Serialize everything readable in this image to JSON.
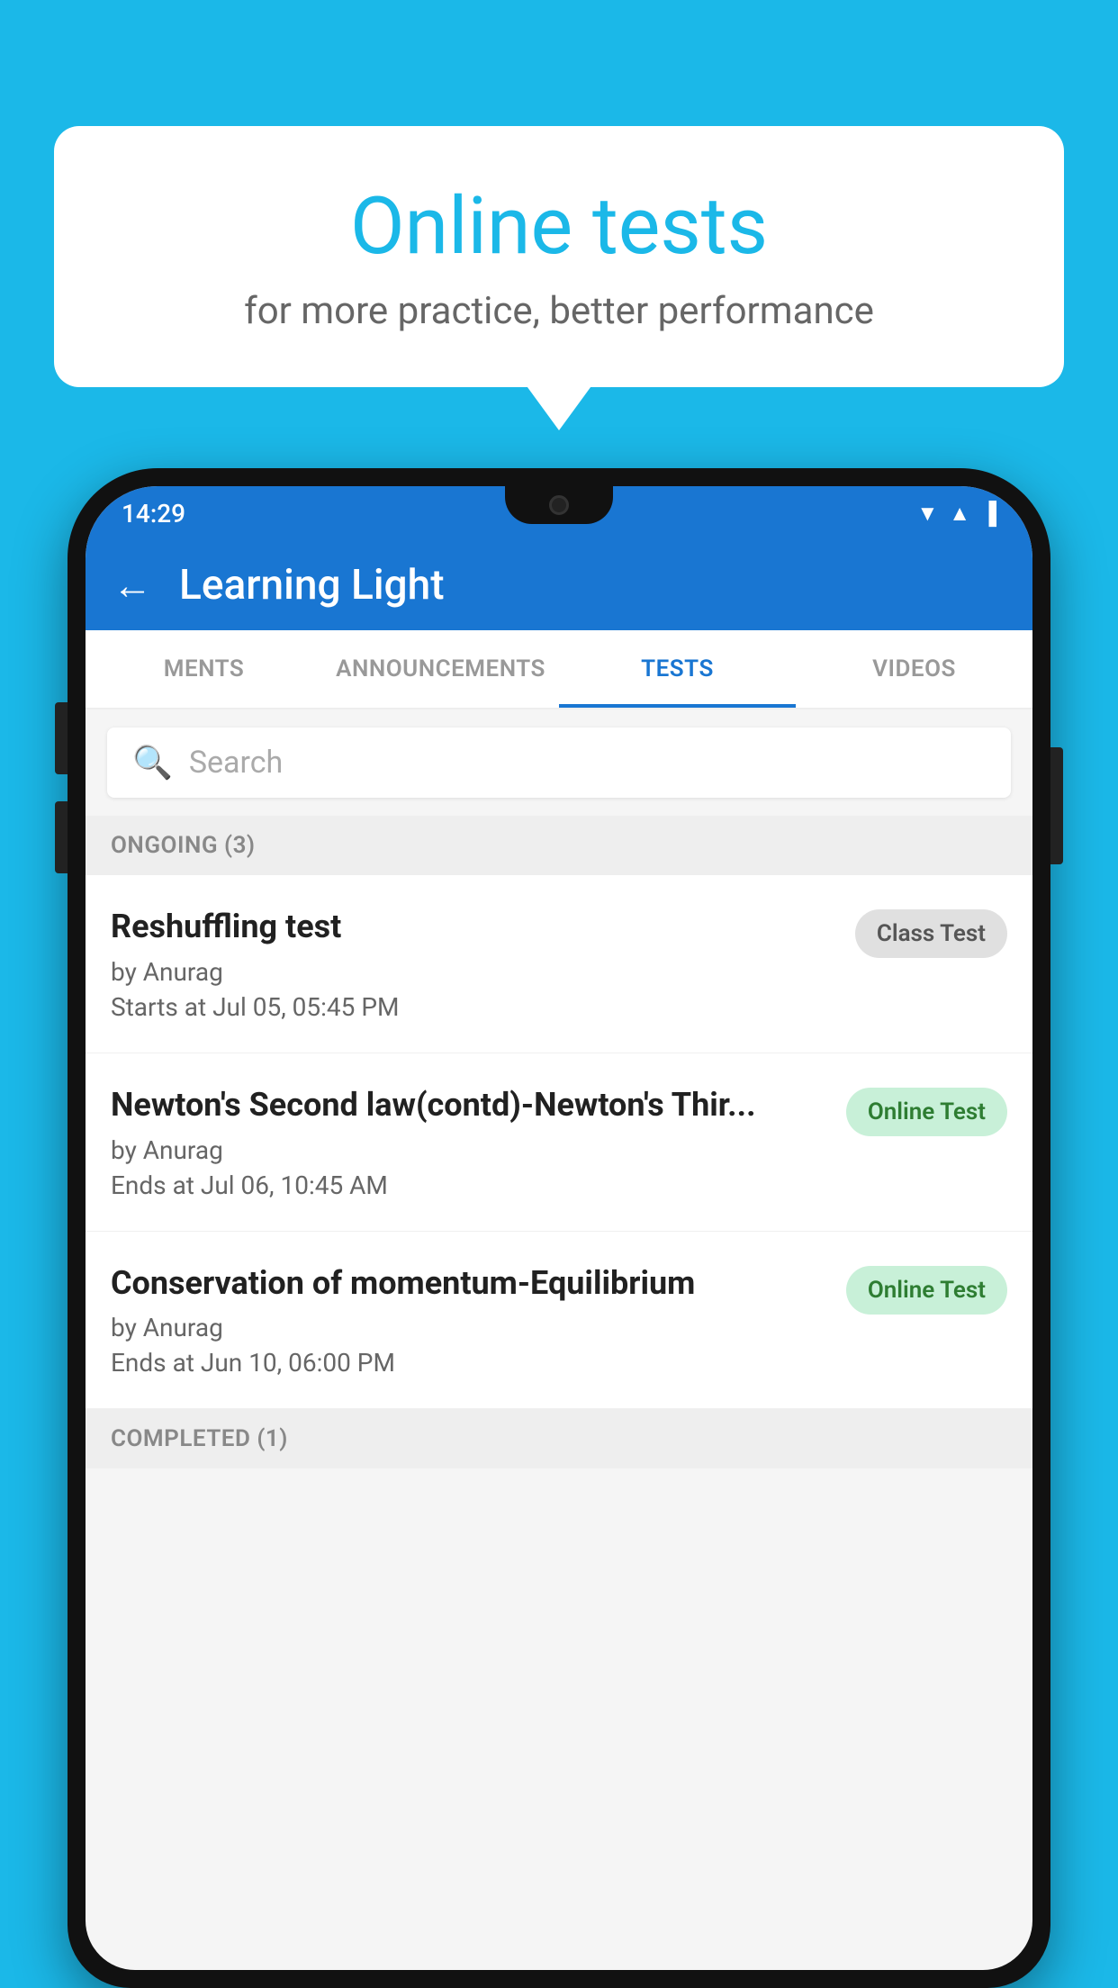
{
  "background_color": "#1BB8E8",
  "speech_bubble": {
    "title": "Online tests",
    "subtitle": "for more practice, better performance"
  },
  "status_bar": {
    "time": "14:29"
  },
  "app_bar": {
    "title": "Learning Light",
    "back_label": "←"
  },
  "tabs": [
    {
      "label": "MENTS",
      "active": false
    },
    {
      "label": "ANNOUNCEMENTS",
      "active": false
    },
    {
      "label": "TESTS",
      "active": true
    },
    {
      "label": "VIDEOS",
      "active": false
    }
  ],
  "search": {
    "placeholder": "Search"
  },
  "sections": [
    {
      "title": "ONGOING (3)",
      "tests": [
        {
          "name": "Reshuffling test",
          "author": "by Anurag",
          "time": "Starts at  Jul 05, 05:45 PM",
          "badge": "Class Test",
          "badge_type": "class"
        },
        {
          "name": "Newton's Second law(contd)-Newton's Thir...",
          "author": "by Anurag",
          "time": "Ends at  Jul 06, 10:45 AM",
          "badge": "Online Test",
          "badge_type": "online"
        },
        {
          "name": "Conservation of momentum-Equilibrium",
          "author": "by Anurag",
          "time": "Ends at  Jun 10, 06:00 PM",
          "badge": "Online Test",
          "badge_type": "online"
        }
      ]
    }
  ],
  "completed_section_label": "COMPLETED (1)"
}
